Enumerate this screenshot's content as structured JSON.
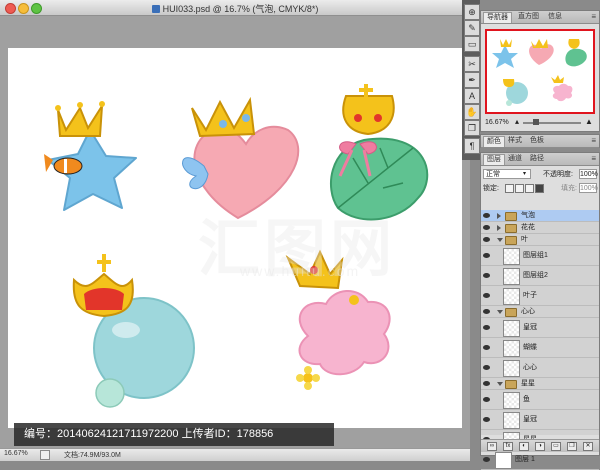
{
  "window": {
    "title": "HUI033.psd @ 16.7% (气泡, CMYK/8*)",
    "zoom": "16.67%",
    "doc_size": "文档:74.9M/93.0M"
  },
  "watermark": {
    "info": "编号：20140624121711972200 上传者ID：178856",
    "logo_text": "汇图网",
    "logo_sub": "www.huitu.com"
  },
  "tool_strip": {
    "icons": [
      "move-icon",
      "brush-icon",
      "eraser-icon",
      "paint-icon",
      "pen-icon",
      "text-icon",
      "hand-icon",
      "zoom-icon",
      "layer-icon",
      "paragraph-icon"
    ]
  },
  "navigator_panel": {
    "tabs": [
      "导航器",
      "直方图",
      "信息"
    ],
    "zoom": "16.67%"
  },
  "color_panel": {
    "tabs": [
      "颜色",
      "样式",
      "色板"
    ]
  },
  "layers_panel": {
    "tabs": [
      "图层",
      "通道",
      "路径"
    ],
    "blend_mode": "正常",
    "opacity_label": "不透明度:",
    "opacity": "100%",
    "lock_label": "锁定:",
    "fill_label": "填充:",
    "fill": "100%",
    "rows": [
      {
        "name": "气泡",
        "type": "group",
        "selected": true,
        "level": 0,
        "open": false
      },
      {
        "name": "花花",
        "type": "group",
        "selected": false,
        "level": 0,
        "open": false
      },
      {
        "name": "叶",
        "type": "group",
        "selected": false,
        "level": 0,
        "open": true
      },
      {
        "name": "图层组1",
        "type": "layer",
        "selected": false,
        "level": 1
      },
      {
        "name": "图层组2",
        "type": "layer",
        "selected": false,
        "level": 1
      },
      {
        "name": "叶子",
        "type": "layer",
        "selected": false,
        "level": 1
      },
      {
        "name": "心心",
        "type": "group",
        "selected": false,
        "level": 0,
        "open": true
      },
      {
        "name": "皇冠",
        "type": "layer",
        "selected": false,
        "level": 1
      },
      {
        "name": "蝴蝶",
        "type": "layer",
        "selected": false,
        "level": 1
      },
      {
        "name": "心心",
        "type": "layer",
        "selected": false,
        "level": 1
      },
      {
        "name": "星星",
        "type": "group",
        "selected": false,
        "level": 0,
        "open": true
      },
      {
        "name": "鱼",
        "type": "layer",
        "selected": false,
        "level": 1
      },
      {
        "name": "皇冠",
        "type": "layer",
        "selected": false,
        "level": 1
      },
      {
        "name": "星星",
        "type": "layer",
        "selected": false,
        "level": 1
      },
      {
        "name": "图层 1",
        "type": "background",
        "selected": false,
        "level": 0
      }
    ],
    "footer_icons": [
      "link-icon",
      "fx-icon",
      "mask-icon",
      "adjustment-icon",
      "new-group-icon",
      "new-layer-icon",
      "trash-icon"
    ]
  },
  "colors": {
    "selection": "#aecbf2",
    "nav_frame": "#e0141e",
    "star": "#7cc3ea",
    "heart": "#f6a9b3",
    "leaf": "#5fc291",
    "bubble": "#9ed7dc",
    "cloud": "#f7b4cf",
    "crown": "#f4c21b",
    "crown_gem": "#e2352a"
  }
}
